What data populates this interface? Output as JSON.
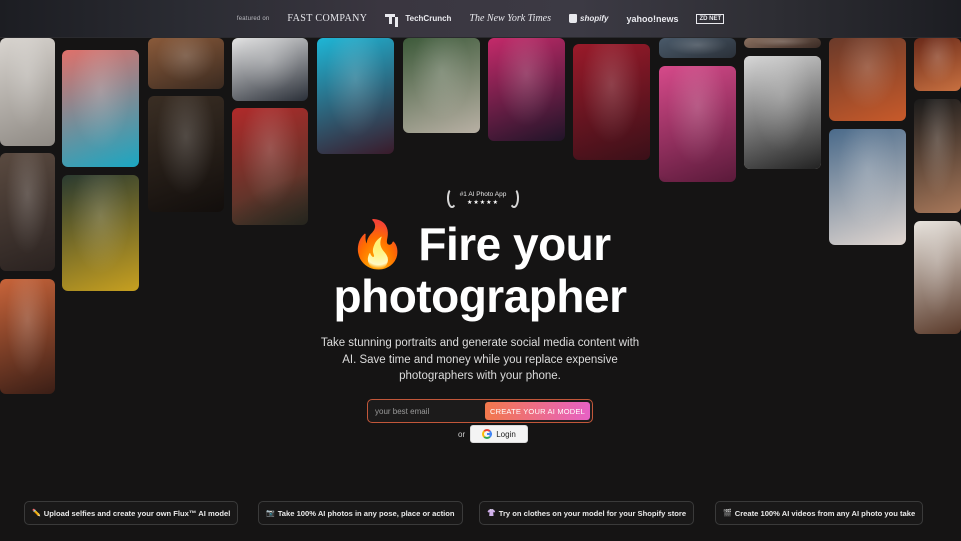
{
  "featured": {
    "label": "featured on",
    "logos": [
      {
        "name": "fast-company",
        "text": "FAST COMPANY"
      },
      {
        "name": "techcrunch",
        "text": "TechCrunch"
      },
      {
        "name": "nytimes",
        "text": "The New York Times"
      },
      {
        "name": "shopify",
        "text": "shopify"
      },
      {
        "name": "yahoo-news",
        "text": "yahoo!news"
      },
      {
        "name": "zdnet",
        "text": "ZD NET"
      }
    ]
  },
  "tiles": [
    {
      "name": "photo-statue",
      "colors": [
        "#d8d4cf",
        "#8f8a84"
      ]
    },
    {
      "name": "photo-pool-woman",
      "colors": [
        "#e0706a",
        "#1aa7c2"
      ]
    },
    {
      "name": "photo-man-tie",
      "colors": [
        "#8a5a3a",
        "#3a2a20"
      ]
    },
    {
      "name": "photo-pilot",
      "colors": [
        "#e4e4e4",
        "#2a2f38"
      ]
    },
    {
      "name": "photo-curly-woman",
      "colors": [
        "#5a4a40",
        "#2a2220"
      ]
    },
    {
      "name": "photo-graduate",
      "colors": [
        "#3a2e24",
        "#120e0c"
      ]
    },
    {
      "name": "photo-santa-woman",
      "colors": [
        "#b02a2a",
        "#3a3a2a"
      ]
    },
    {
      "name": "photo-football-player",
      "colors": [
        "#2a3a30",
        "#c7a020"
      ]
    },
    {
      "name": "photo-sunset-couch",
      "colors": [
        "#c8643a",
        "#3a1e16"
      ]
    },
    {
      "name": "photo-pool-bikini",
      "colors": [
        "#1eb6d6",
        "#3a1a2a"
      ]
    },
    {
      "name": "photo-yoga",
      "colors": [
        "#3d5a3a",
        "#b8b0a4"
      ]
    },
    {
      "name": "photo-dj",
      "colors": [
        "#c42a6a",
        "#201428"
      ]
    },
    {
      "name": "photo-neon-woman",
      "colors": [
        "#9a1a2a",
        "#3a1018"
      ]
    },
    {
      "name": "photo-pink-hair",
      "colors": [
        "#d64a8a",
        "#5a1a3a"
      ]
    },
    {
      "name": "photo-man-sand",
      "colors": [
        "#9a8a7a",
        "#c8c2b8"
      ]
    },
    {
      "name": "photo-man-black-shirt",
      "colors": [
        "#d8d8d8",
        "#222222"
      ]
    },
    {
      "name": "photo-leather-jacket",
      "colors": [
        "#6a3a2a",
        "#c85a2a"
      ]
    },
    {
      "name": "photo-brunette",
      "colors": [
        "#4a6a8a",
        "#e0d6d0"
      ]
    },
    {
      "name": "photo-candles",
      "colors": [
        "#6a2a1a",
        "#c87040"
      ]
    },
    {
      "name": "photo-shirtless-man",
      "colors": [
        "#1a1a1a",
        "#a8785a"
      ]
    },
    {
      "name": "photo-dog",
      "colors": [
        "#e8e4de",
        "#5a3a2a"
      ]
    },
    {
      "name": "photo-top-a",
      "colors": [
        "#4a5a6a",
        "#2a3038"
      ]
    },
    {
      "name": "photo-top-b",
      "colors": [
        "#8a7060",
        "#3a2a24"
      ]
    }
  ],
  "hero": {
    "badge_title": "#1 AI Photo App",
    "badge_stars": "★★★★★",
    "headline_line1": "🔥 Fire your",
    "headline_line2": "photographer",
    "subtitle": "Take stunning portraits and generate social media content with AI. Save time and money while you replace expensive photographers with your phone."
  },
  "signup": {
    "email_placeholder": "your best email",
    "cta_label": "CREATE YOUR AI MODEL",
    "or_text": "or",
    "google_label": "Login"
  },
  "features": [
    {
      "icon": "✏️",
      "icon_name": "pencil-icon",
      "label": "Upload selfies and create your own Flux™ AI model"
    },
    {
      "icon": "📷",
      "icon_name": "camera-icon",
      "label": "Take 100% AI photos in any pose, place or action"
    },
    {
      "icon": "👚",
      "icon_name": "clothes-icon",
      "label": "Try on clothes on your model for your Shopify store"
    },
    {
      "icon": "🎬",
      "icon_name": "video-icon",
      "label": "Create 100% AI videos from any AI photo you take"
    }
  ],
  "colors": {
    "background": "#151414",
    "cta_gradient_start": "#f2784b",
    "cta_gradient_end": "#e761c5",
    "input_border": "#c2573a"
  }
}
